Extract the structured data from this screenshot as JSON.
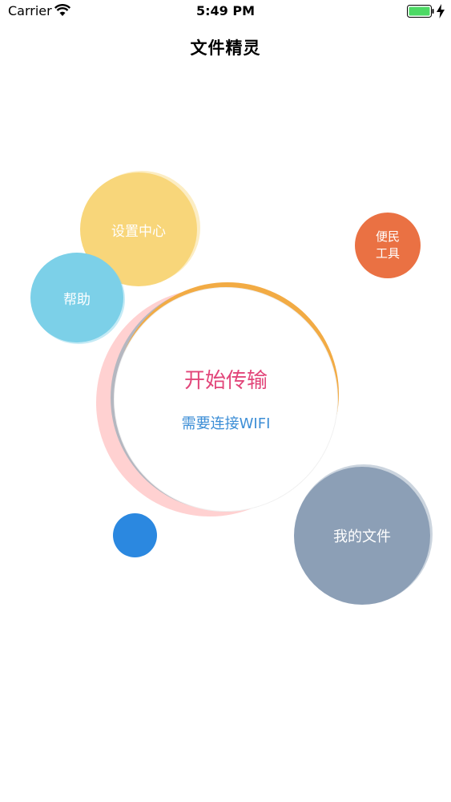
{
  "status_bar": {
    "carrier": "Carrier",
    "time": "5:49 PM",
    "icons": [
      "wifi-icon",
      "battery-icon",
      "charging-bolt-icon"
    ]
  },
  "nav": {
    "title": "文件精灵"
  },
  "bubbles": {
    "settings": {
      "label": "设置中心",
      "color": "#f8d67a"
    },
    "help": {
      "label": "帮助",
      "color": "#7cd0e8"
    },
    "tools": {
      "line1": "便民",
      "line2": "工具",
      "color": "#ea7143"
    },
    "my_files": {
      "label": "我的文件",
      "color": "#8c9fb6"
    },
    "blue_dot": {
      "color": "#2b88e0"
    }
  },
  "transfer": {
    "title": "开始传输",
    "subtitle": "需要连接WIFI",
    "title_color": "#e2467a",
    "subtitle_color": "#3c8ed6"
  }
}
